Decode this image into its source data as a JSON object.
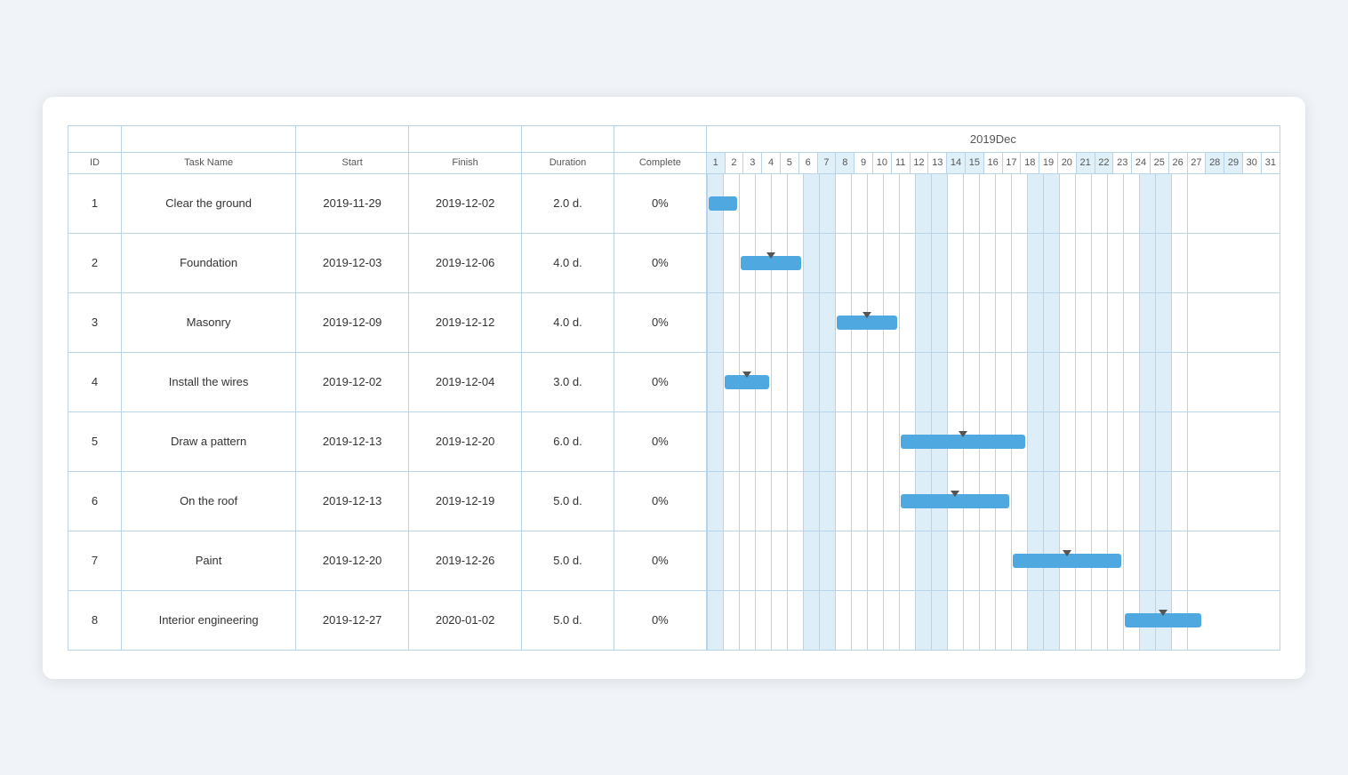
{
  "table": {
    "headers": {
      "id": "ID",
      "taskName": "Task Name",
      "start": "Start",
      "finish": "Finish",
      "duration": "Duration",
      "complete": "Complete",
      "monthLabel": "2019Dec"
    },
    "days": [
      1,
      2,
      3,
      4,
      5,
      6,
      7,
      8,
      9,
      10,
      11,
      12,
      13,
      14,
      15,
      16,
      17,
      18,
      19,
      20,
      21,
      22,
      23,
      24,
      25,
      26,
      27,
      28,
      29,
      30,
      31
    ],
    "weekends": [
      1,
      7,
      8,
      14,
      15,
      21,
      22,
      28,
      29
    ],
    "rows": [
      {
        "id": 1,
        "name": "Clear the ground",
        "start": "2019-11-29",
        "finish": "2019-12-02",
        "duration": "2.0 d.",
        "complete": "0%",
        "barStart": 1,
        "barLen": 2
      },
      {
        "id": 2,
        "name": "Foundation",
        "start": "2019-12-03",
        "finish": "2019-12-06",
        "duration": "4.0 d.",
        "complete": "0%",
        "barStart": 3,
        "barLen": 4
      },
      {
        "id": 3,
        "name": "Masonry",
        "start": "2019-12-09",
        "finish": "2019-12-12",
        "duration": "4.0 d.",
        "complete": "0%",
        "barStart": 9,
        "barLen": 4
      },
      {
        "id": 4,
        "name": "Install the wires",
        "start": "2019-12-02",
        "finish": "2019-12-04",
        "duration": "3.0 d.",
        "complete": "0%",
        "barStart": 2,
        "barLen": 3
      },
      {
        "id": 5,
        "name": "Draw a pattern",
        "start": "2019-12-13",
        "finish": "2019-12-20",
        "duration": "6.0 d.",
        "complete": "0%",
        "barStart": 13,
        "barLen": 8
      },
      {
        "id": 6,
        "name": "On the roof",
        "start": "2019-12-13",
        "finish": "2019-12-19",
        "duration": "5.0 d.",
        "complete": "0%",
        "barStart": 13,
        "barLen": 7
      },
      {
        "id": 7,
        "name": "Paint",
        "start": "2019-12-20",
        "finish": "2019-12-26",
        "duration": "5.0 d.",
        "complete": "0%",
        "barStart": 20,
        "barLen": 7
      },
      {
        "id": 8,
        "name": "Interior engineering",
        "start": "2019-12-27",
        "finish": "2020-01-02",
        "duration": "5.0 d.",
        "complete": "0%",
        "barStart": 27,
        "barLen": 5
      }
    ]
  }
}
